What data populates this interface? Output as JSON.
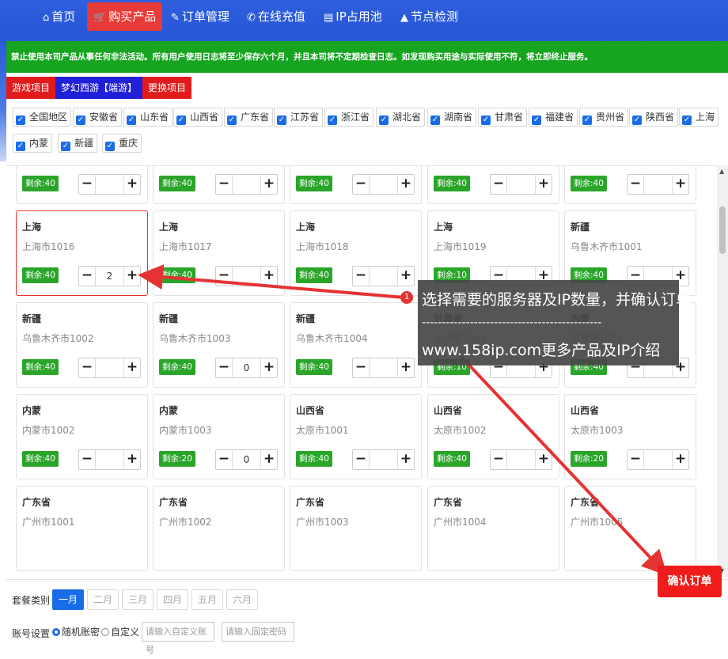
{
  "nav": {
    "items": [
      {
        "icon": "⌂",
        "label": "首页"
      },
      {
        "icon": "🛒",
        "label": "购买产品"
      },
      {
        "icon": "✎",
        "label": "订单管理"
      },
      {
        "icon": "✆",
        "label": "在线充值"
      },
      {
        "icon": "▤",
        "label": "IP占用池"
      },
      {
        "icon": "▲",
        "label": "节点检测"
      }
    ],
    "active_index": 1
  },
  "notice": "禁止使用本司产品从事任何非法活动。所有用户使用日志将至少保存六个月，并且本司将不定期检查日志。如发现购买用途与实际使用不符，将立即终止服务。",
  "tags": [
    "游戏项目",
    "梦幻西游【端游】",
    "更换项目"
  ],
  "regions": [
    "全国地区",
    "安徽省",
    "山东省",
    "山西省",
    "广东省",
    "江苏省",
    "浙江省",
    "湖北省",
    "湖南省",
    "甘肃省",
    "福建省",
    "贵州省",
    "陕西省",
    "上海",
    "内蒙",
    "新疆",
    "重庆"
  ],
  "cards": [
    {
      "province": "",
      "city": "",
      "badge": "剩余:40",
      "qty": ""
    },
    {
      "province": "",
      "city": "",
      "badge": "剩余:40",
      "qty": ""
    },
    {
      "province": "",
      "city": "",
      "badge": "剩余:40",
      "qty": ""
    },
    {
      "province": "",
      "city": "",
      "badge": "剩余:40",
      "qty": ""
    },
    {
      "province": "",
      "city": "",
      "badge": "剩余:40",
      "qty": ""
    },
    {
      "province": "上海",
      "city": "上海市1016",
      "badge": "剩余:40",
      "qty": "2"
    },
    {
      "province": "上海",
      "city": "上海市1017",
      "badge": "剩余:40",
      "qty": ""
    },
    {
      "province": "上海",
      "city": "上海市1018",
      "badge": "剩余:40",
      "qty": ""
    },
    {
      "province": "上海",
      "city": "上海市1019",
      "badge": "剩余:10",
      "qty": ""
    },
    {
      "province": "新疆",
      "city": "乌鲁木齐市1001",
      "badge": "剩余:40",
      "qty": ""
    },
    {
      "province": "新疆",
      "city": "乌鲁木齐市1002",
      "badge": "剩余:40",
      "qty": ""
    },
    {
      "province": "新疆",
      "city": "乌鲁木齐市1003",
      "badge": "剩余:40",
      "qty": "0"
    },
    {
      "province": "新疆",
      "city": "乌鲁木齐市1004",
      "badge": "剩余:40",
      "qty": ""
    },
    {
      "province": "甘肃省",
      "city": "兰州市1001",
      "badge": "剩余:10",
      "qty": ""
    },
    {
      "province": "内蒙",
      "city": "内蒙市1001",
      "badge": "剩余:40",
      "qty": ""
    },
    {
      "province": "内蒙",
      "city": "内蒙市1002",
      "badge": "剩余:40",
      "qty": ""
    },
    {
      "province": "内蒙",
      "city": "内蒙市1003",
      "badge": "剩余:20",
      "qty": "0"
    },
    {
      "province": "山西省",
      "city": "太原市1001",
      "badge": "剩余:40",
      "qty": ""
    },
    {
      "province": "山西省",
      "city": "太原市1002",
      "badge": "剩余:40",
      "qty": ""
    },
    {
      "province": "山西省",
      "city": "太原市1003",
      "badge": "剩余:20",
      "qty": ""
    },
    {
      "province": "广东省",
      "city": "广州市1001",
      "badge": "",
      "qty": ""
    },
    {
      "province": "广东省",
      "city": "广州市1002",
      "badge": "",
      "qty": ""
    },
    {
      "province": "广东省",
      "city": "广州市1003",
      "badge": "",
      "qty": ""
    },
    {
      "province": "广东省",
      "city": "广州市1004",
      "badge": "",
      "qty": ""
    },
    {
      "province": "广东省",
      "city": "广州市1005",
      "badge": "",
      "qty": ""
    }
  ],
  "stepper": {
    "minus": "−",
    "plus": "+"
  },
  "bottom": {
    "package_label": "套餐类别",
    "months": [
      "一月",
      "二月",
      "三月",
      "四月",
      "五月",
      "六月"
    ],
    "active_month": 0,
    "account_label": "账号设置",
    "radio_random": "随机账密",
    "radio_custom": "自定义",
    "custom_account_placeholder": "请输入自定义账号",
    "fixed_password_placeholder": "请输入固定密码"
  },
  "confirm_button": "确认订单",
  "tooltip": {
    "marker": "1",
    "line1": "选择需要的服务器及IP数量，并确认订单",
    "divider": "---------------------------------------------",
    "line2": "www.158ip.com更多产品及IP介绍"
  },
  "colors": {
    "nav": "#2f5fdc",
    "active_nav": "#e83a36",
    "notice": "#17a420",
    "badge": "#2aa52a",
    "primary": "#1b6ce8",
    "confirm": "#ef1c1c",
    "arrow": "#e53333"
  }
}
